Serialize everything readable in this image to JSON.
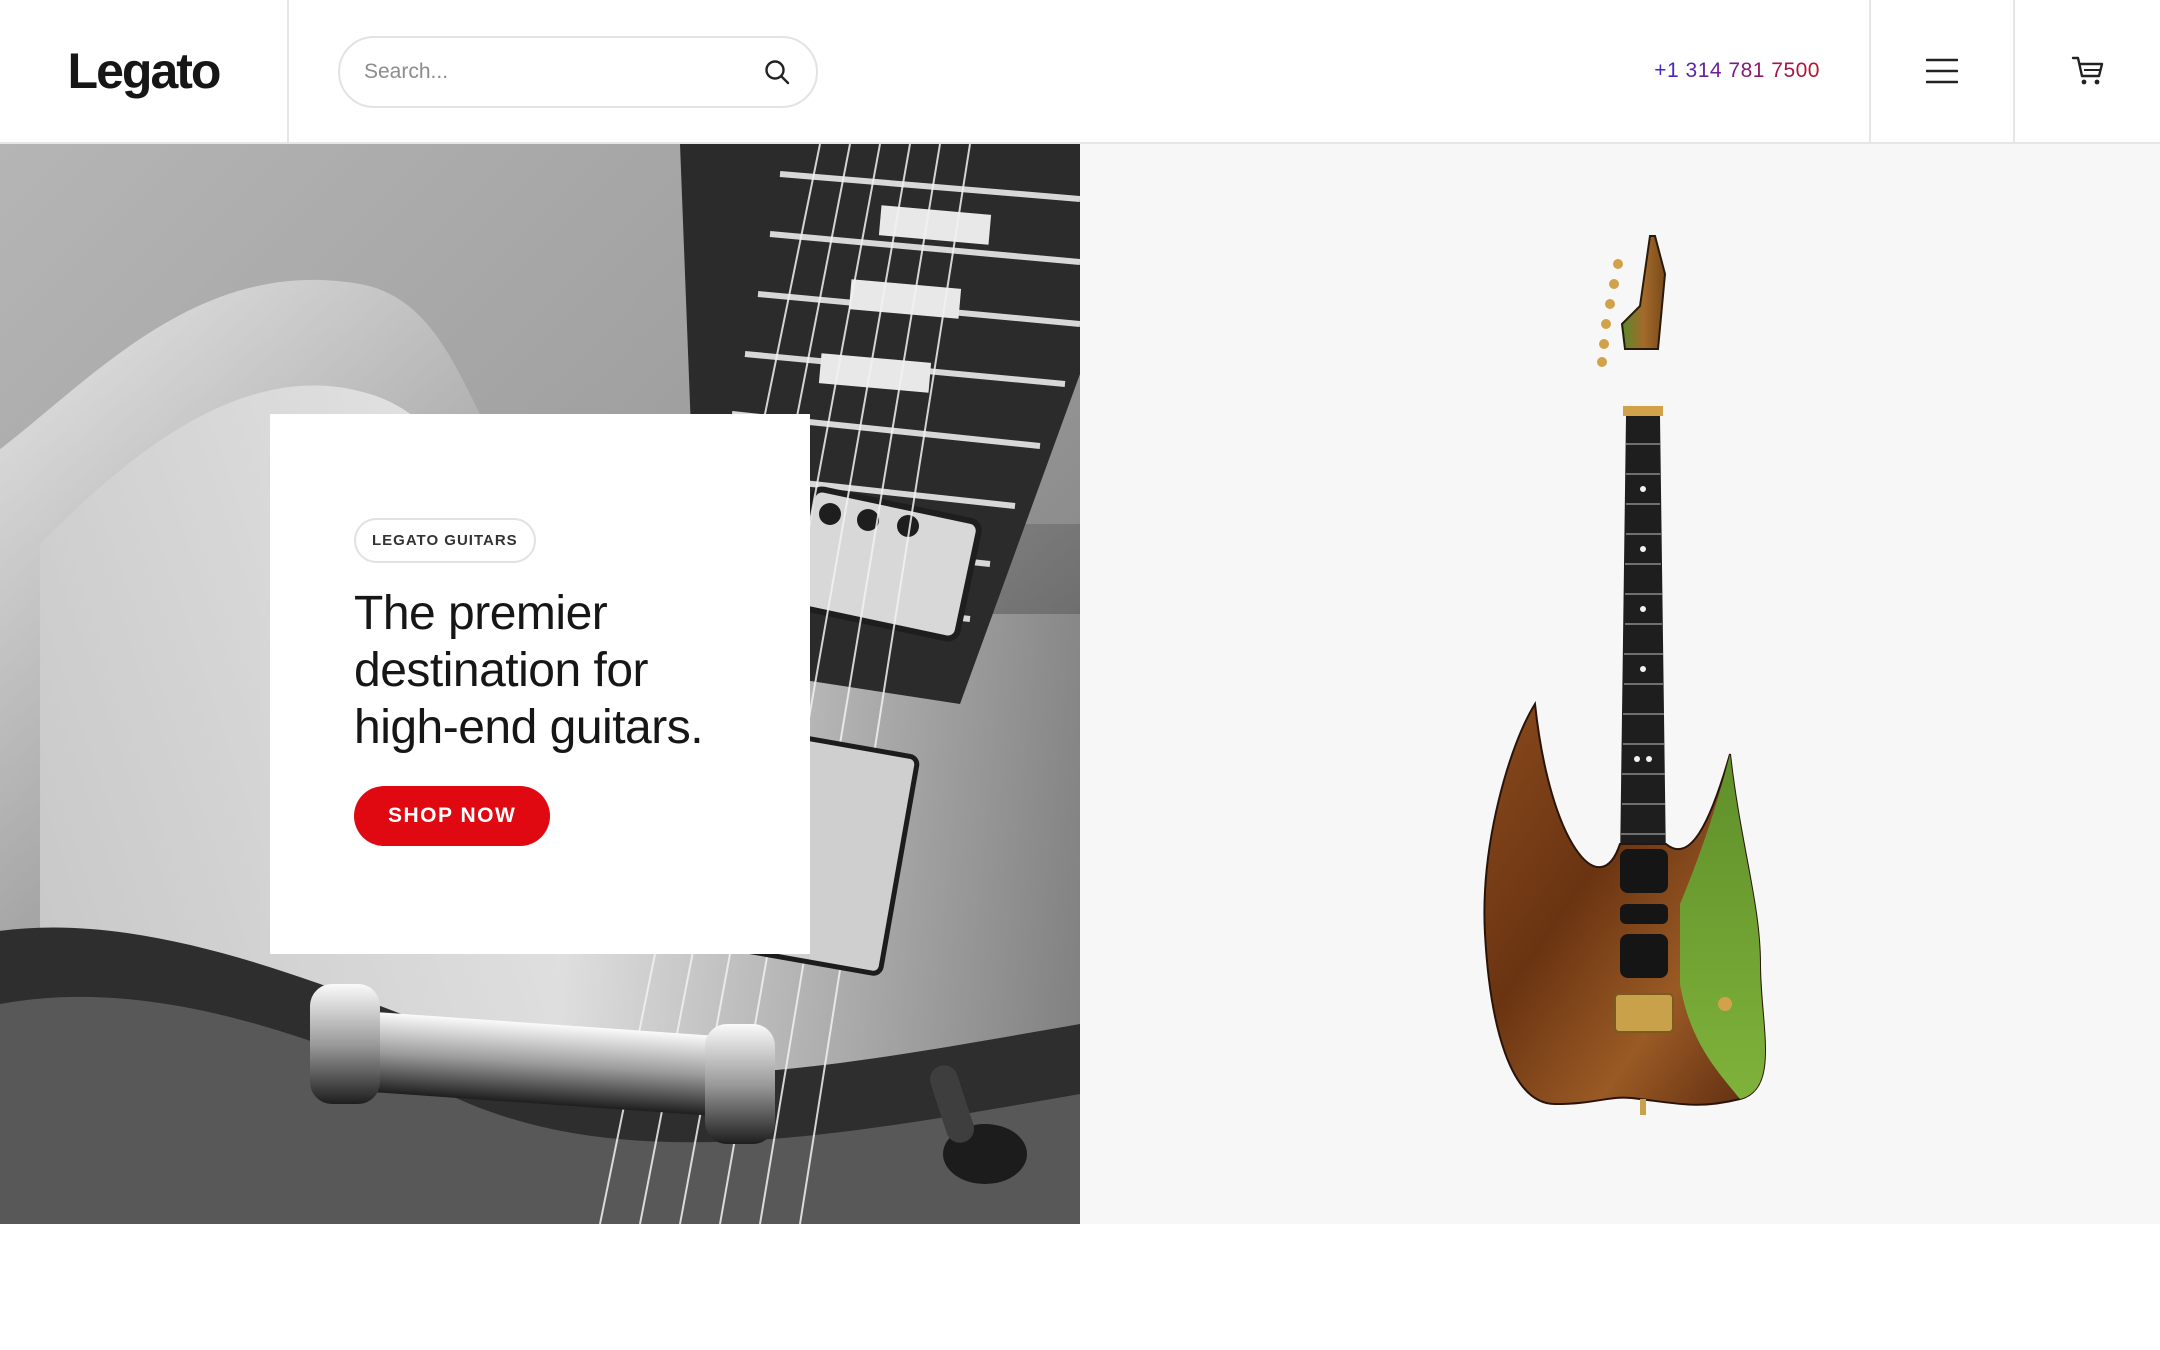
{
  "header": {
    "logo": "Legato",
    "search": {
      "placeholder": "Search...",
      "value": ""
    },
    "phone": "+1 314 781 7500",
    "icons": {
      "search": "search-icon",
      "menu": "hamburger-menu-icon",
      "cart": "cart-icon"
    }
  },
  "hero": {
    "badge": "LEGATO GUITARS",
    "headline": "The premier destination for high-end guitars.",
    "cta_label": "SHOP NOW"
  },
  "colors": {
    "accent": "#e00811",
    "phone_gradient_start": "#3a2ad0",
    "phone_gradient_end": "#c0102a",
    "right_panel_bg": "#f7f7f7"
  }
}
